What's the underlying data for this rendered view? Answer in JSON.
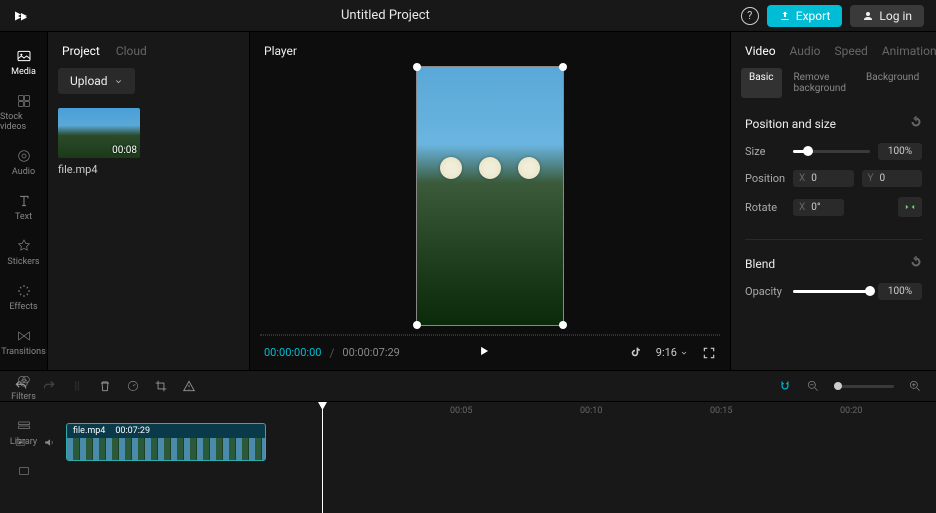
{
  "header": {
    "title": "Untitled Project",
    "export_label": "Export",
    "login_label": "Log in"
  },
  "sidebar": {
    "items": [
      {
        "label": "Media"
      },
      {
        "label": "Stock videos"
      },
      {
        "label": "Audio"
      },
      {
        "label": "Text"
      },
      {
        "label": "Stickers"
      },
      {
        "label": "Effects"
      },
      {
        "label": "Transitions"
      },
      {
        "label": "Filters"
      },
      {
        "label": "Library"
      }
    ]
  },
  "media_panel": {
    "tabs": {
      "project": "Project",
      "cloud": "Cloud"
    },
    "upload_label": "Upload",
    "items": [
      {
        "duration": "00:08",
        "name": "file.mp4"
      }
    ]
  },
  "player": {
    "title": "Player",
    "current": "00:00:00:00",
    "total": "00:00:07:29",
    "ratio": "9:16"
  },
  "props": {
    "tabs": {
      "video": "Video",
      "audio": "Audio",
      "speed": "Speed",
      "animation": "Animation"
    },
    "subtabs": {
      "basic": "Basic",
      "rmbg": "Remove background",
      "bg": "Background"
    },
    "pos_section": "Position and size",
    "size_label": "Size",
    "size_value": "100%",
    "position_label": "Position",
    "pos_x": "0",
    "pos_y": "0",
    "rotate_label": "Rotate",
    "rotate_val": "0°",
    "blend_section": "Blend",
    "opacity_label": "Opacity",
    "opacity_value": "100%"
  },
  "timeline": {
    "ticks": [
      "00:05",
      "00:10",
      "00:15",
      "00:20"
    ],
    "clip": {
      "name": "file.mp4",
      "duration": "00:07:29"
    }
  }
}
